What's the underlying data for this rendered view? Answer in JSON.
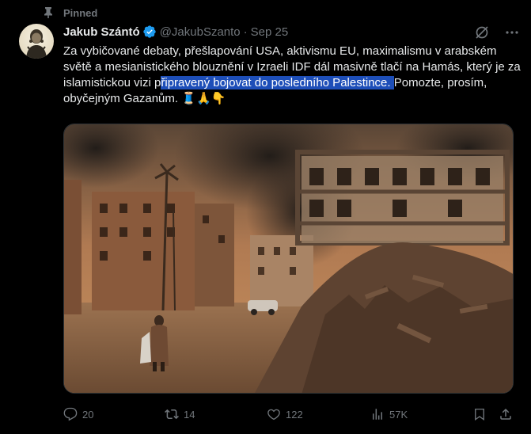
{
  "pinned": {
    "label": "Pinned",
    "icon": "pin-icon"
  },
  "author": {
    "display_name": "Jakub Szántó",
    "handle": "@JakubSzanto",
    "date": "Sep 25",
    "verified": true,
    "verified_color": "#1d9bf0"
  },
  "tweet": {
    "text_before": "Za vybičované debaty, přešlapování USA, aktivismu EU, maximalismu v arabském světě a mesianistického blouznění v Izraeli IDF dál masivně tlačí na Hamás, který je za islamistickou vizi p",
    "text_highlighted": "řipravený bojovat do posledního Palestince. ",
    "text_after": "Pomozte, prosím, obyčejným Gazanům.",
    "emoji": [
      "🧵",
      "🙏",
      "👇"
    ],
    "highlight_color": "#1d4eb8"
  },
  "media": {
    "icon": "ruined-city-image"
  },
  "actions": {
    "replies": "20",
    "reposts": "14",
    "likes": "122",
    "views": "57K"
  }
}
